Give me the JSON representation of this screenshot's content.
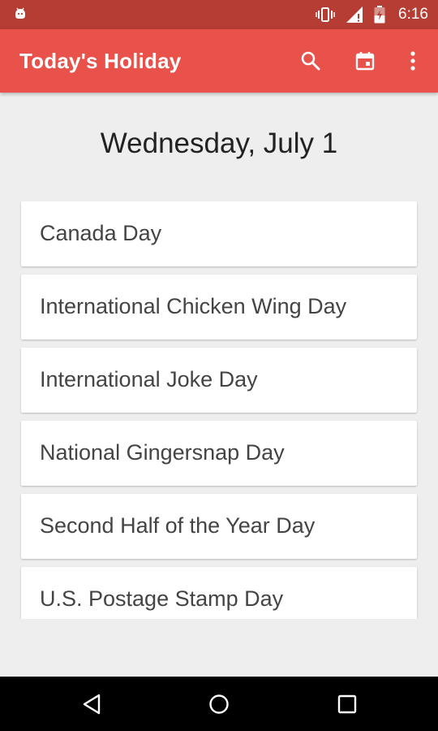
{
  "status_bar": {
    "time": "6:16",
    "icons": [
      "android-icon",
      "vibrate-icon",
      "signal-icon",
      "battery-charging-icon"
    ]
  },
  "app_bar": {
    "title": "Today's Holiday",
    "actions": [
      "search-icon",
      "calendar-icon",
      "overflow-menu-icon"
    ]
  },
  "date": "Wednesday, July 1",
  "holidays": [
    "Canada Day",
    "International Chicken Wing Day",
    "International Joke Day",
    "National Gingersnap Day",
    "Second Half of the Year Day",
    "U.S. Postage Stamp Day"
  ],
  "nav_bar": {
    "buttons": [
      "back-icon",
      "home-icon",
      "recents-icon"
    ]
  },
  "colors": {
    "status_bar": "#b53d33",
    "app_bar": "#e8524a",
    "background": "#eeeeee",
    "card": "#ffffff",
    "nav_bar": "#000000"
  }
}
